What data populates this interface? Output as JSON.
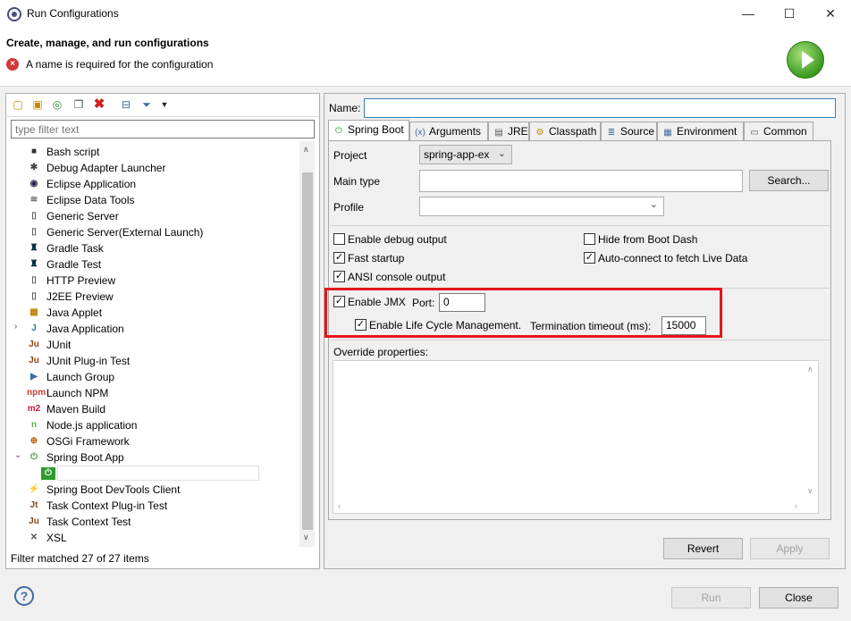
{
  "window": {
    "title": "Run Configurations",
    "minimize": "—",
    "maximize": "☐",
    "close": "✕"
  },
  "banner": {
    "title": "Create, manage, and run configurations",
    "error": "A name is required for the configuration"
  },
  "left": {
    "filter_placeholder": "type filter text",
    "items": [
      {
        "label": "Bash script",
        "icon": "bash-icon"
      },
      {
        "label": "Debug Adapter Launcher",
        "icon": "debug-adapter-icon"
      },
      {
        "label": "Eclipse Application",
        "icon": "eclipse-icon"
      },
      {
        "label": "Eclipse Data Tools",
        "icon": "database-icon"
      },
      {
        "label": "Generic Server",
        "icon": "server-icon"
      },
      {
        "label": "Generic Server(External Launch)",
        "icon": "server-icon"
      },
      {
        "label": "Gradle Task",
        "icon": "gradle-icon"
      },
      {
        "label": "Gradle Test",
        "icon": "gradle-icon"
      },
      {
        "label": "HTTP Preview",
        "icon": "http-icon"
      },
      {
        "label": "J2EE Preview",
        "icon": "j2ee-icon"
      },
      {
        "label": "Java Applet",
        "icon": "applet-icon"
      },
      {
        "label": "Java Application",
        "icon": "java-app-icon"
      },
      {
        "label": "JUnit",
        "icon": "junit-icon"
      },
      {
        "label": "JUnit Plug-in Test",
        "icon": "junit-plugin-icon"
      },
      {
        "label": "Launch Group",
        "icon": "launch-group-icon"
      },
      {
        "label": "Launch NPM",
        "icon": "npm-icon"
      },
      {
        "label": "Maven Build",
        "icon": "maven-icon"
      },
      {
        "label": "Node.js application",
        "icon": "nodejs-icon"
      },
      {
        "label": "OSGi Framework",
        "icon": "osgi-icon"
      },
      {
        "label": "Spring Boot App",
        "icon": "spring-boot-icon"
      },
      {
        "label": "",
        "icon": "spring-boot-icon"
      },
      {
        "label": "Spring Boot DevTools Client",
        "icon": "devtools-icon"
      },
      {
        "label": "Task Context Plug-in Test",
        "icon": "task-plugin-icon"
      },
      {
        "label": "Task Context Test",
        "icon": "task-test-icon"
      },
      {
        "label": "XSL",
        "icon": "xsl-icon"
      }
    ],
    "status": "Filter matched 27 of 27 items"
  },
  "right": {
    "name_label": "Name:",
    "name_value": "",
    "tabs": [
      "Spring Boot",
      "Arguments",
      "JRE",
      "Classpath",
      "Source",
      "Environment",
      "Common"
    ],
    "project_label": "Project",
    "project_value": "spring-app-ex",
    "main_type_label": "Main type",
    "search_button": "Search...",
    "profile_label": "Profile",
    "checks": {
      "debug_output": "Enable debug output",
      "hide_boot_dash": "Hide from Boot Dash",
      "fast_startup": "Fast startup",
      "auto_connect": "Auto-connect to fetch Live Data",
      "ansi_output": "ANSI console output",
      "enable_jmx": "Enable JMX",
      "lifecycle": "Enable Life Cycle Management."
    },
    "port_label": "Port:",
    "port_value": "0",
    "timeout_label": "Termination timeout (ms):",
    "timeout_value": "15000",
    "override_label": "Override properties:",
    "revert_button": "Revert",
    "apply_button": "Apply"
  },
  "footer": {
    "run_button": "Run",
    "close_button": "Close",
    "help": "?"
  },
  "colors": {
    "highlight": "#e8141b",
    "spring_green": "#2f9a2f"
  }
}
